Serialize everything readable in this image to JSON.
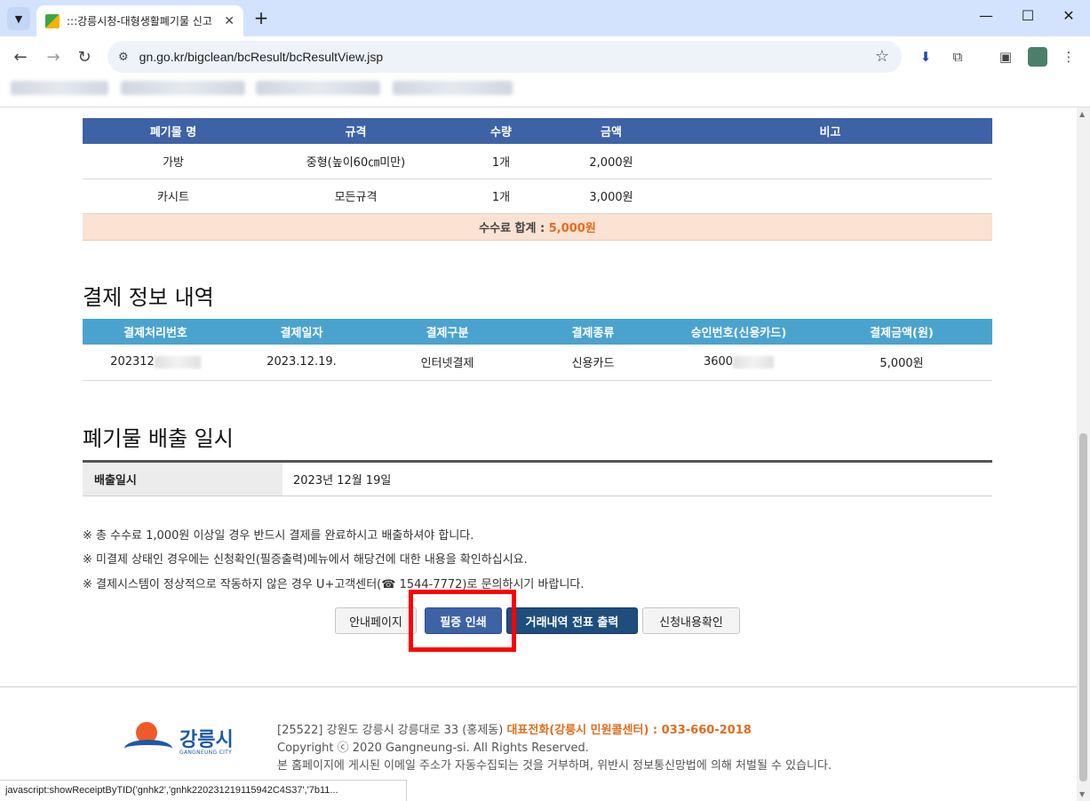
{
  "browser": {
    "tab_title": ":::강릉시청-대형생활폐기물 신고",
    "tab_close": "✕",
    "new_tab": "+",
    "url": "gn.go.kr/bigclean/bcResult/bcResultView.jsp",
    "status_text": "javascript:showReceiptByTID('gnhk2','gnhk220231219115942C4S37','7b11..."
  },
  "waste_table": {
    "headers": [
      "폐기물 명",
      "규격",
      "수량",
      "금액",
      "비고"
    ],
    "rows": [
      {
        "name": "가방",
        "spec": "중형(높이60㎝미만)",
        "qty": "1개",
        "amount": "2,000원",
        "note": ""
      },
      {
        "name": "카시트",
        "spec": "모든규격",
        "qty": "1개",
        "amount": "3,000원",
        "note": ""
      }
    ],
    "total_label": "수수료 합계 : ",
    "total_amount": "5,000원"
  },
  "payment": {
    "section_title": "결제 정보 내역",
    "headers": [
      "결제처리번호",
      "결제일자",
      "결제구분",
      "결제종류",
      "승인번호(신용카드)",
      "결제금액(원)"
    ],
    "row": {
      "tid_prefix": "202312",
      "date": "2023.12.19.",
      "method": "인터넷결제",
      "type": "신용카드",
      "approval_prefix": "3600",
      "amount": "5,000원"
    }
  },
  "disposal": {
    "section_title": "폐기물 배출 일시",
    "label": "배출일시",
    "value": "2023년 12월 19일"
  },
  "notices": [
    "※ 총 수수료 1,000원 이상일 경우 반드시 결제를 완료하시고 배출하셔야 합니다.",
    "※ 미결제 상태인 경우에는 신청확인(필증출력)메뉴에서 해당건에 대한 내용을 확인하십시요.",
    "※ 결제시스템이 정상적으로 작동하지 않은 경우 U+고객센터(☎ 1544-7772)로 문의하시기 바랍니다."
  ],
  "buttons": {
    "guide": "안내페이지",
    "print": "필증 인쇄",
    "receipt": "거래내역 전표 출력",
    "check": "신청내용확인"
  },
  "footer": {
    "logo_name": "강릉시",
    "logo_sub": "GANGNEUNG CITY",
    "address": "[25522] 강원도 강릉시 강릉대로 33 (홍제동) ",
    "phone": "대표전화(강릉시 민원콜센터) : 033-660-2018",
    "copyright": "Copyright ⓒ 2020 Gangneung-si. All Rights Reserved.",
    "email_notice": "본 홈페이지에 게시된 이메일 주소가 자동수집되는 것을 거부하며, 위반시 정보통신망법에 의해 처벌될 수 있습니다."
  },
  "colors": {
    "waste_header": "#3d62a6",
    "pay_header": "#4aa3cf",
    "total_bg": "#fbe2d2",
    "accent_orange": "#e06d1e",
    "highlight": "#ff0000"
  }
}
